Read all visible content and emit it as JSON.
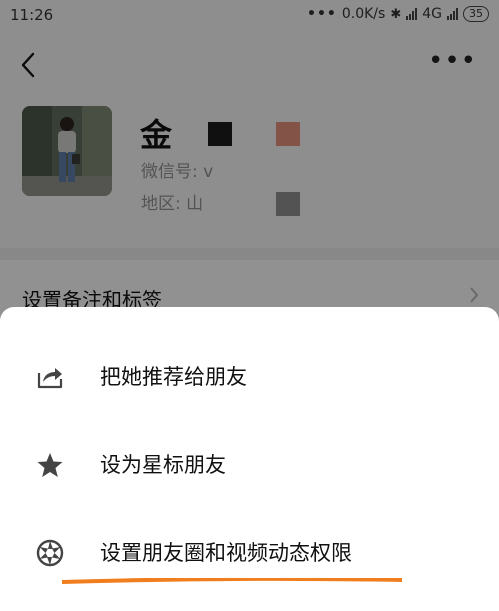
{
  "status_bar": {
    "time": "11:26",
    "dots": "•••",
    "speed": "0.0K/s",
    "network_label": "4G",
    "battery": "35"
  },
  "profile": {
    "name_partial": "金",
    "wechat_id_label": "微信号: v",
    "region_label": "地区: 山",
    "colors": {
      "swatch_dark": "#1c1c1c",
      "swatch_orange": "#d98a75",
      "swatch_gray": "#8a8a8a"
    }
  },
  "remark_row": {
    "label": "设置备注和标签"
  },
  "action_sheet": {
    "items": [
      {
        "label": "把她推荐给朋友",
        "icon": "share-icon"
      },
      {
        "label": "设为星标朋友",
        "icon": "star-icon"
      },
      {
        "label": "设置朋友圈和视频动态权限",
        "icon": "moments-aperture-icon"
      }
    ],
    "highlight_color": "#f07d1e"
  }
}
